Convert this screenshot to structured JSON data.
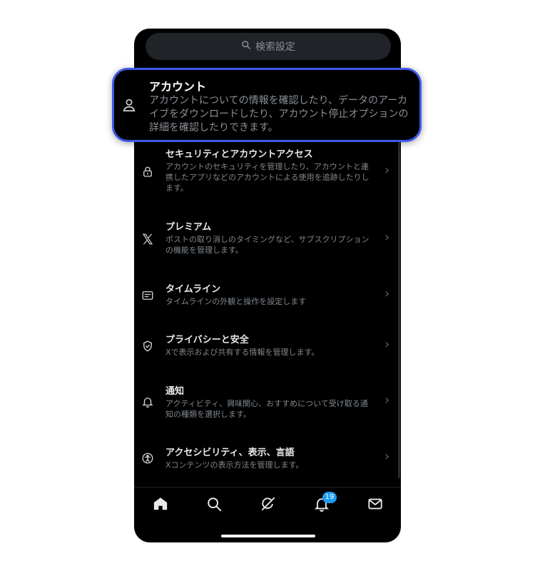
{
  "search": {
    "placeholder": "検索設定"
  },
  "highlight": {
    "title": "アカウント",
    "description": "アカウントについての情報を確認したり、データのアーカイブをダウンロードしたり、アカウント停止オプションの詳細を確認したりできます。",
    "icon": "person-icon"
  },
  "settings": {
    "items": [
      {
        "title": "セキュリティとアカウントアクセス",
        "description": "アカウントのセキュリティを管理したり、アカウントと連携したアプリなどのアカウントによる使用を追跡したりします。",
        "icon": "lock-icon"
      },
      {
        "title": "プレミアム",
        "description": "ポストの取り消しのタイミングなど、サブスクリプションの機能を管理します。",
        "icon": "x-logo-icon"
      },
      {
        "title": "タイムライン",
        "description": "タイムラインの外観と操作を設定します",
        "icon": "timeline-icon"
      },
      {
        "title": "プライバシーと安全",
        "description": "Xで表示および共有する情報を管理します。",
        "icon": "shield-icon"
      },
      {
        "title": "通知",
        "description": "アクティビティ、興味関心、おすすめについて受け取る通知の種類を選択します。",
        "icon": "bell-icon"
      },
      {
        "title": "アクセシビリティ、表示、言語",
        "description": "Xコンテンツの表示方法を管理します。",
        "icon": "accessibility-icon"
      }
    ]
  },
  "tabbar": {
    "tabs": [
      "home-icon",
      "search-icon",
      "grok-icon",
      "notifications-icon",
      "messages-icon"
    ],
    "notification_badge": "19"
  }
}
